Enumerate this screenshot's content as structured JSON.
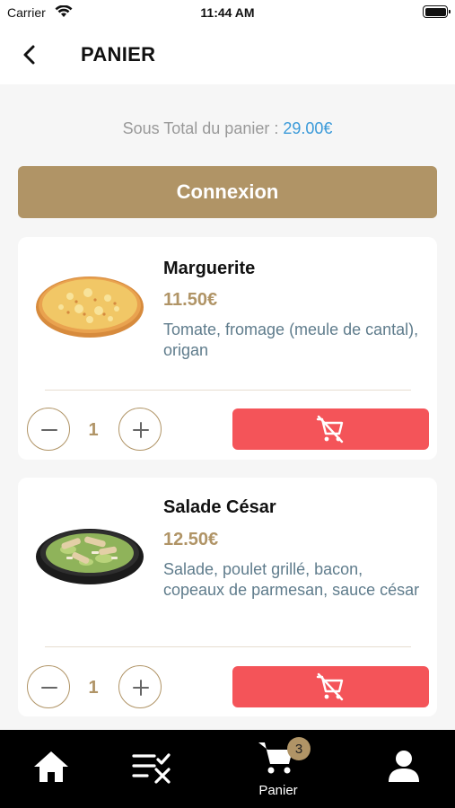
{
  "status_bar": {
    "carrier": "Carrier",
    "time": "11:44 AM"
  },
  "header": {
    "title": "PANIER"
  },
  "subtotal": {
    "label": "Sous Total du panier :",
    "amount": "29.00€"
  },
  "connexion_button": {
    "label": "Connexion"
  },
  "cart_items": [
    {
      "name": "Marguerite",
      "price": "11.50€",
      "description": "Tomate, fromage (meule de cantal), origan",
      "quantity": "1"
    },
    {
      "name": "Salade César",
      "price": "12.50€",
      "description": "Salade, poulet grillé, bacon, copeaux de parmesan, sauce césar",
      "quantity": "1"
    }
  ],
  "tab_bar": {
    "tabs": [
      {
        "icon": "home-icon"
      },
      {
        "icon": "checklist-icon"
      },
      {
        "icon": "cart-icon",
        "label": "Panier",
        "badge": "3"
      },
      {
        "icon": "user-icon"
      }
    ]
  },
  "colors": {
    "accent": "#b09466",
    "remove": "#f45459",
    "link": "#3a9ad9",
    "description": "#5f7c8c"
  }
}
